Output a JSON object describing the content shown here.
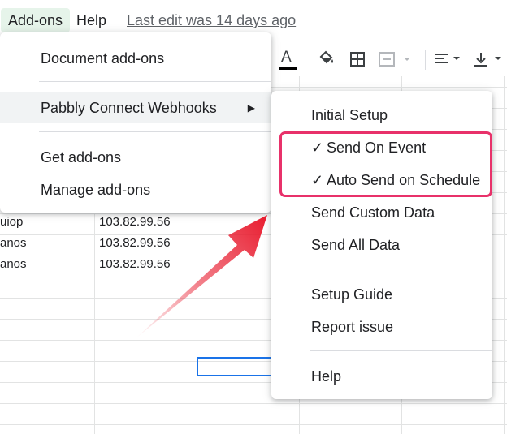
{
  "menubar": {
    "addons": "Add-ons",
    "help": "Help",
    "last_edit": "Last edit was 14 days ago"
  },
  "toolbar": {
    "text_color_letter": "A",
    "icons": [
      "text-color-icon",
      "fill-color-icon",
      "borders-icon",
      "merge-cells-icon",
      "horizontal-align-icon",
      "vertical-align-icon"
    ],
    "text_color_underline": "#000000"
  },
  "grid": {
    "rows": [
      {
        "col_a": "uiop",
        "col_b": "103.82.99.56"
      },
      {
        "col_a": "anos",
        "col_b": "103.82.99.56"
      },
      {
        "col_a": "anos",
        "col_b": "103.82.99.56"
      }
    ]
  },
  "addons_menu": {
    "items": [
      {
        "label": "Document add-ons"
      },
      {
        "label": "Pabbly Connect Webhooks"
      },
      {
        "label": "Get add-ons"
      },
      {
        "label": "Manage add-ons"
      }
    ]
  },
  "pabbly_menu": {
    "check_mark": "✓",
    "items": [
      {
        "label": "Initial Setup"
      },
      {
        "label": "Send On Event"
      },
      {
        "label": "Auto Send on Schedule"
      },
      {
        "label": "Send Custom Data"
      },
      {
        "label": "Send All Data"
      },
      {
        "label": "Setup Guide"
      },
      {
        "label": "Report issue"
      },
      {
        "label": "Help"
      }
    ]
  },
  "colors": {
    "highlight_border": "#e8316a",
    "arrow": "#e8192c",
    "selection": "#1a73e8",
    "addons_active_bg": "#e6f4ea"
  }
}
